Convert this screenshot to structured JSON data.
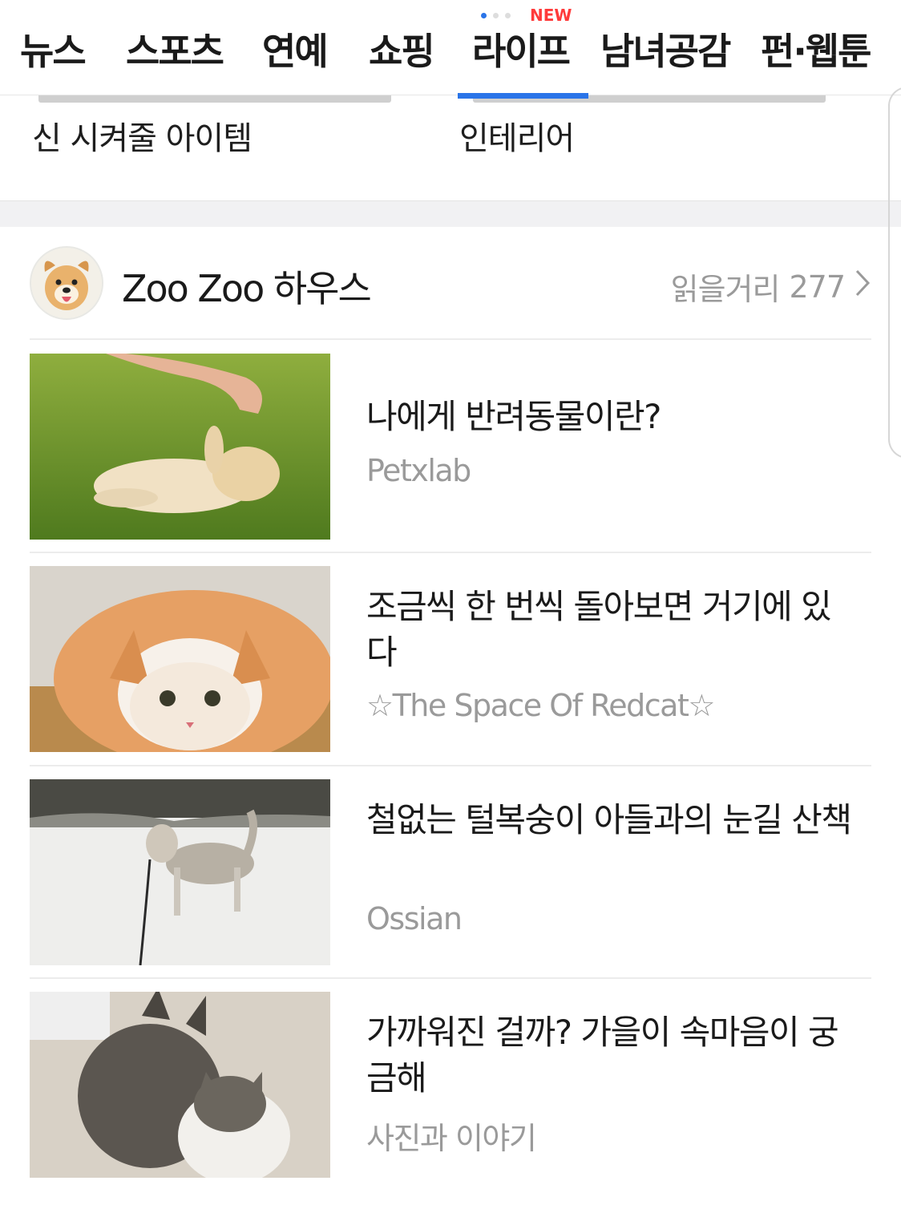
{
  "nav": {
    "tabs": [
      {
        "label": "뉴스"
      },
      {
        "label": "스포츠"
      },
      {
        "label": "연예"
      },
      {
        "label": "쇼핑"
      },
      {
        "label": "라이프"
      },
      {
        "label": "남녀공감"
      },
      {
        "label": "펀·웹툰"
      }
    ],
    "new_badge": "NEW",
    "active_color": "#2a74e8"
  },
  "previous_items": [
    {
      "title": "신 시켜줄 아이템"
    },
    {
      "title": "인테리어"
    }
  ],
  "section": {
    "title": "Zoo Zoo 하우스",
    "read_more_label": "읽을거리",
    "read_more_count": "277",
    "avatar_icon": "puppy-avatar"
  },
  "articles": [
    {
      "title": "나에게 반려동물이란?",
      "source": "Petxlab",
      "thumb": "puppy-with-hand-on-grass"
    },
    {
      "title": "조금씩 한 번씩 돌아보면 거기에 있다",
      "source": "☆The Space Of Redcat☆",
      "thumb": "orange-cat-lying"
    },
    {
      "title": "철없는 털복숭이 아들과의 눈길 산책",
      "source": "Ossian",
      "thumb": "husky-in-snow"
    },
    {
      "title": "가까워진 걸까? 가을이 속마음이 궁금해",
      "source": "사진과 이야기",
      "thumb": "two-cats-nuzzling"
    }
  ]
}
